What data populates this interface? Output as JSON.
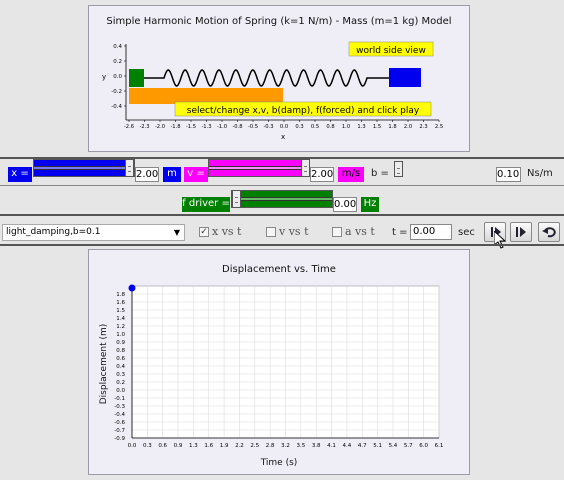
{
  "sim": {
    "title": "Simple Harmonic Motion of Spring (k=1 N/m) - Mass (m=1 kg) Model",
    "world_label": "world side view",
    "hint": "select/change x,v, b(damp), f(forced) and click play",
    "y_axis_label": "y",
    "x_axis_label": "x",
    "y_ticks": [
      "0.4",
      "0.2",
      "0.0",
      "-0.2",
      "-0.4"
    ],
    "x_ticks": [
      "-2.6",
      "-2.3",
      "-2.0",
      "-1.8",
      "-1.5",
      "-1.3",
      "-1.0",
      "-0.8",
      "-0.5",
      "-0.3",
      "0.0",
      "0.3",
      "0.5",
      "0.8",
      "1.0",
      "1.3",
      "1.5",
      "1.8",
      "2.0",
      "2.3",
      "2.5"
    ]
  },
  "controls": {
    "x_label": "x =",
    "x_value": "2.00",
    "x_unit": "m",
    "x_slider_level": 1.0,
    "v_label": "v =",
    "v_value": "2.00",
    "v_unit": "m/s",
    "v_slider_level": 1.0,
    "b_label": "b =",
    "b_value": "0.10",
    "b_unit": "Ns/m",
    "f_label": "f driver =",
    "f_value": "0.00",
    "f_unit": "Hz",
    "f_slider_level": 0.0
  },
  "options": {
    "preset_selected": "light_damping,b=0.1",
    "x_vs_t": "x vs t",
    "x_vs_t_checked": "✓",
    "v_vs_t": "v vs t",
    "a_vs_t": "a vs t",
    "t_label": "t =",
    "t_value": "0.00",
    "t_unit": "sec"
  },
  "colors": {
    "blue": "#0000ee",
    "magenta": "#ff00ff",
    "green": "#008000",
    "orange": "#ff9900",
    "yellow": "#ffff00"
  },
  "chart_data": {
    "type": "scatter",
    "title": "Displacement vs. Time",
    "xlabel": "Time (s)",
    "ylabel": "Displacement (m)",
    "xlim": [
      0.0,
      6.1
    ],
    "ylim": [
      -0.9,
      1.8
    ],
    "x_ticks": [
      "0.0",
      "0.3",
      "0.6",
      "0.9",
      "1.3",
      "1.6",
      "1.9",
      "2.2",
      "2.5",
      "2.8",
      "3.2",
      "3.5",
      "3.8",
      "4.1",
      "4.4",
      "4.7",
      "5.1",
      "5.4",
      "5.7",
      "6.0",
      "6.1"
    ],
    "y_ticks": [
      "1.8",
      "1.6",
      "1.5",
      "1.4",
      "1.2",
      "1.0",
      "0.9",
      "0.8",
      "0.6",
      "0.4",
      "0.3",
      "0.2",
      "0.0",
      "-0.1",
      "-0.3",
      "-0.4",
      "-0.6",
      "-0.7",
      "-0.9"
    ],
    "grid": true,
    "series": [
      {
        "x": [
          0.0
        ],
        "y": [
          2.0
        ]
      }
    ]
  }
}
